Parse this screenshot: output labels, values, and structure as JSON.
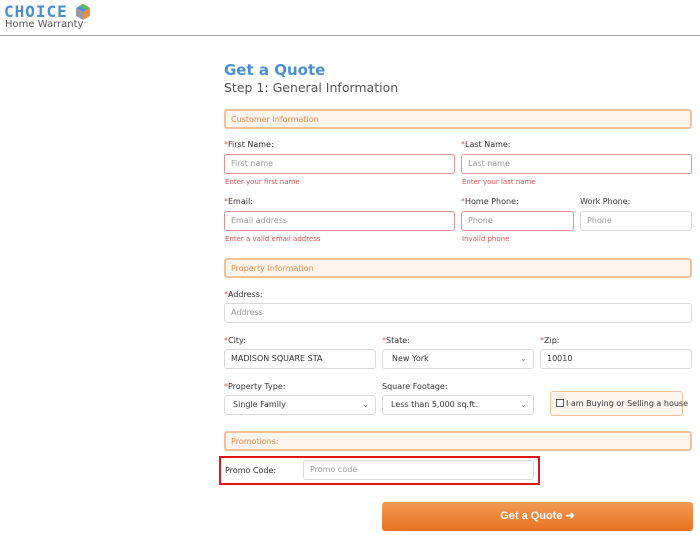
{
  "header": {
    "logo_main": "CHOICE",
    "logo_sub": "Home Warranty"
  },
  "page": {
    "title": "Get a Quote",
    "subtitle": "Step 1: General Information"
  },
  "sections": {
    "customer": "Customer Information",
    "property": "Property Information",
    "promotions": "Promotions:"
  },
  "required_mark": "*",
  "customer": {
    "first_name": {
      "label": "First Name:",
      "placeholder": "First name",
      "error": "Enter your first name"
    },
    "last_name": {
      "label": "Last Name:",
      "placeholder": "Last name",
      "error": "Enter your last name"
    },
    "email": {
      "label": "Email:",
      "placeholder": "Email address",
      "error": "Enter a valid email address"
    },
    "home_phone": {
      "label": "Home Phone:",
      "placeholder": "Phone",
      "error": "Invalid phone"
    },
    "work_phone": {
      "label": "Work Phone:",
      "placeholder": "Phone"
    }
  },
  "property": {
    "address": {
      "label": "Address:",
      "placeholder": "Address"
    },
    "city": {
      "label": "City:",
      "value": "MADISON SQUARE STA"
    },
    "state": {
      "label": "State:",
      "value": "New York"
    },
    "zip": {
      "label": "Zip:",
      "value": "10010"
    },
    "property_type": {
      "label": "Property Type:",
      "value": "Single Family"
    },
    "square_footage": {
      "label": "Square Footage:",
      "value": "Less than 5,000 sq.ft."
    },
    "buying_selling": {
      "label": "I am Buying or Selling a house",
      "checked": false
    }
  },
  "promotions": {
    "promo_code": {
      "label": "Promo Code:",
      "placeholder": "Promo code"
    }
  },
  "submit": {
    "label": "Get a Quote",
    "icon": "arrow-right-icon"
  },
  "colors": {
    "brand_blue": "#4a8fd0",
    "accent_orange": "#e8721f",
    "error_red": "#d9534f",
    "highlight_red": "#e0141b"
  }
}
